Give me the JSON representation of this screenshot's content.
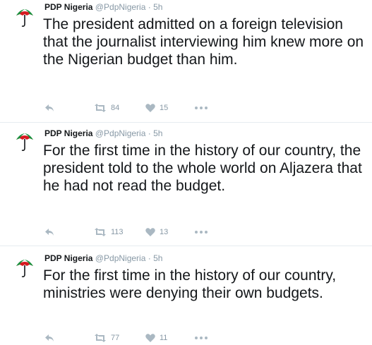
{
  "colors": {
    "text": "#14171a",
    "muted": "#8899a6",
    "icon": "#aab8c2",
    "pdp_red": "#d71920",
    "pdp_green": "#1a8f3c"
  },
  "tweets": [
    {
      "fullname": "PDP Nigeria",
      "username": "@PdpNigeria",
      "separator": "·",
      "time": "5h",
      "avatar_icon": "pdp-umbrella-logo-icon",
      "text": "The president admitted on a foreign television that the journalist interviewing him knew more on the Nigerian budget than him.",
      "retweets": "84",
      "likes": "15"
    },
    {
      "fullname": "PDP Nigeria",
      "username": "@PdpNigeria",
      "separator": "·",
      "time": "5h",
      "avatar_icon": "pdp-umbrella-logo-icon",
      "text": "For the first time in the history of our country, the president told to the whole world on Aljazera that he had not read the budget.",
      "retweets": "113",
      "likes": "13"
    },
    {
      "fullname": "PDP Nigeria",
      "username": "@PdpNigeria",
      "separator": "·",
      "time": "5h",
      "avatar_icon": "pdp-umbrella-logo-icon",
      "text": "For the first time in the history of our country, ministries were denying their own budgets.",
      "retweets": "77",
      "likes": "11"
    }
  ]
}
